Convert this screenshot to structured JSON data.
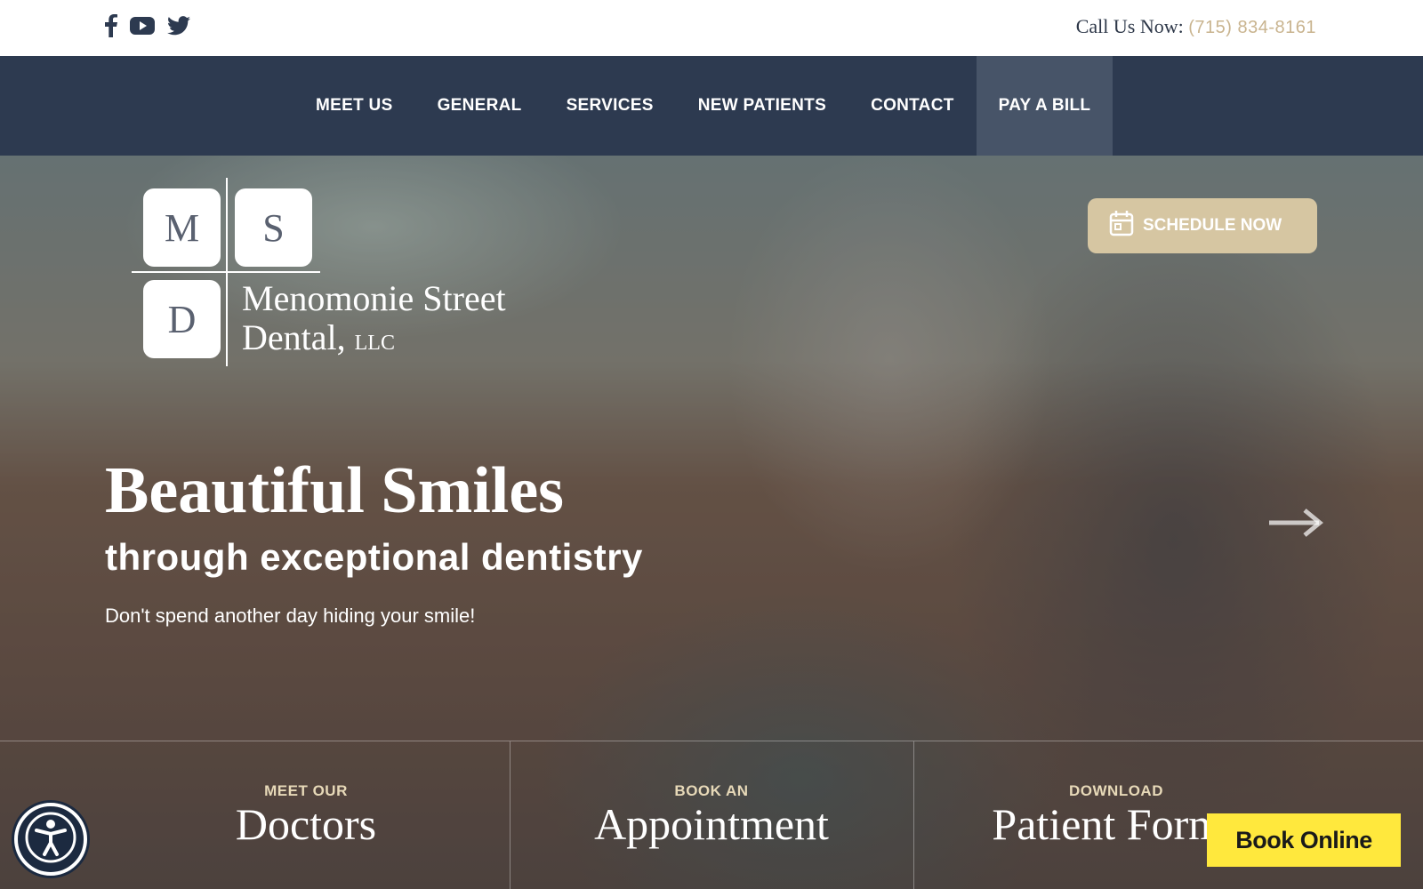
{
  "topbar": {
    "social": [
      {
        "icon": "facebook-icon"
      },
      {
        "icon": "youtube-icon"
      },
      {
        "icon": "twitter-icon"
      }
    ],
    "call_label": "Call Us Now:",
    "phone": "(715) 834-8161"
  },
  "nav": {
    "items": [
      {
        "label": "MEET US"
      },
      {
        "label": "GENERAL"
      },
      {
        "label": "SERVICES"
      },
      {
        "label": "NEW PATIENTS"
      },
      {
        "label": "CONTACT"
      },
      {
        "label": "PAY A BILL",
        "active": true
      }
    ]
  },
  "logo": {
    "letters": [
      "M",
      "S",
      "D"
    ],
    "name_line1": "Menomonie Street",
    "name_line2": "Dental,",
    "name_suffix": "LLC"
  },
  "hero": {
    "schedule_label": "SCHEDULE NOW",
    "headline": "Beautiful Smiles",
    "subheadline": "through exceptional dentistry",
    "tagline": "Don't spend another day hiding your smile!",
    "next_icon": "arrow-right-icon"
  },
  "bottom_links": [
    {
      "small": "MEET OUR",
      "big": "Doctors"
    },
    {
      "small": "BOOK AN",
      "big": "Appointment"
    },
    {
      "small": "DOWNLOAD",
      "big": "Patient Forms"
    }
  ],
  "widgets": {
    "accessibility_icon": "accessibility-icon",
    "book_online_label": "Book Online"
  },
  "colors": {
    "nav_bg": "#2d3a50",
    "nav_active": "#475468",
    "accent_gold": "#c9b48f",
    "book_online": "#ffe83d"
  }
}
